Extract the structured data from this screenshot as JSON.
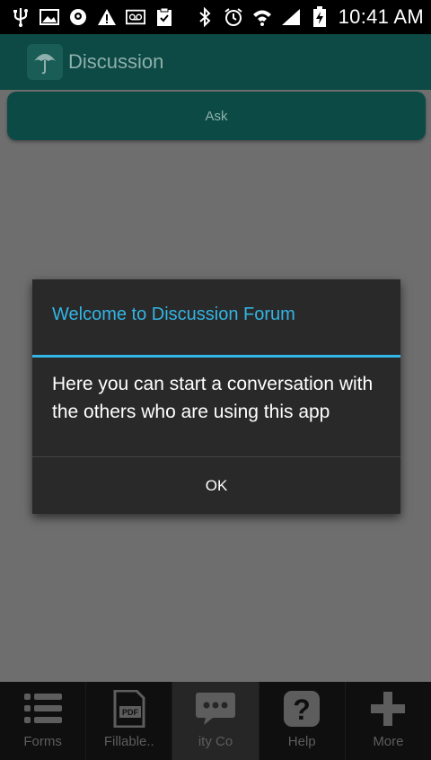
{
  "status_bar": {
    "time": "10:41 AM",
    "left_icons": [
      "usb-icon",
      "image-icon",
      "location-icon",
      "warning-icon",
      "voicemail-icon",
      "clipboard-icon"
    ],
    "right_icons": [
      "bluetooth-icon",
      "alarm-icon",
      "wifi-icon",
      "signal-icon",
      "battery-charging-icon"
    ]
  },
  "action_bar": {
    "title": "Discussion",
    "icon": "umbrella-icon"
  },
  "ask_button": {
    "label": "Ask"
  },
  "dialog": {
    "title": "Welcome to Discussion Forum",
    "message": "Here you can start a conversation with the others who are using this app",
    "ok_label": "OK"
  },
  "tabs": [
    {
      "label": "Forms",
      "icon": "list-icon"
    },
    {
      "label": "Fillable..",
      "icon": "pdf-icon"
    },
    {
      "label": "ity  Co",
      "icon": "chat-icon"
    },
    {
      "label": "Help",
      "icon": "help-icon"
    },
    {
      "label": "More",
      "icon": "plus-icon"
    }
  ],
  "colors": {
    "accent": "#33b5e5",
    "action_bar": "#0d4a45",
    "dialog_bg": "#292929"
  }
}
